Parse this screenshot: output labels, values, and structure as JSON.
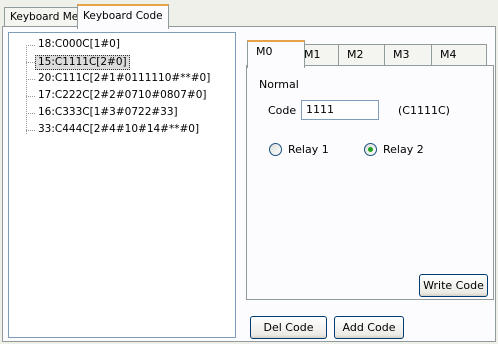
{
  "outer_tabs": [
    {
      "label": "Keyboard Memo",
      "active": false
    },
    {
      "label": "Keyboard Code",
      "active": true
    }
  ],
  "tree": {
    "items": [
      {
        "label": "18:C000C[1#0]",
        "selected": false
      },
      {
        "label": "15:C1111C[2#0]",
        "selected": true
      },
      {
        "label": "20:C111C[2#1#0111110#**#0]",
        "selected": false
      },
      {
        "label": "17:C222C[2#2#0710#0807#0]",
        "selected": false
      },
      {
        "label": "16:C333C[1#3#0722#33]",
        "selected": false
      },
      {
        "label": "33:C444C[2#4#10#14#**#0]",
        "selected": false
      }
    ]
  },
  "inner_tabs": [
    {
      "label": "M0",
      "active": true
    },
    {
      "label": "M1",
      "active": false
    },
    {
      "label": "M2",
      "active": false
    },
    {
      "label": "M3",
      "active": false
    },
    {
      "label": "M4",
      "active": false
    }
  ],
  "panel": {
    "mode_label": "Normal",
    "code_label": "Code",
    "code_value": "1111",
    "code_display": "(C1111C)",
    "relay1_label": "Relay 1",
    "relay2_label": "Relay 2",
    "selected_relay": 2,
    "write_code_label": "Write Code"
  },
  "buttons": {
    "del_code": "Del Code",
    "add_code": "Add Code"
  }
}
